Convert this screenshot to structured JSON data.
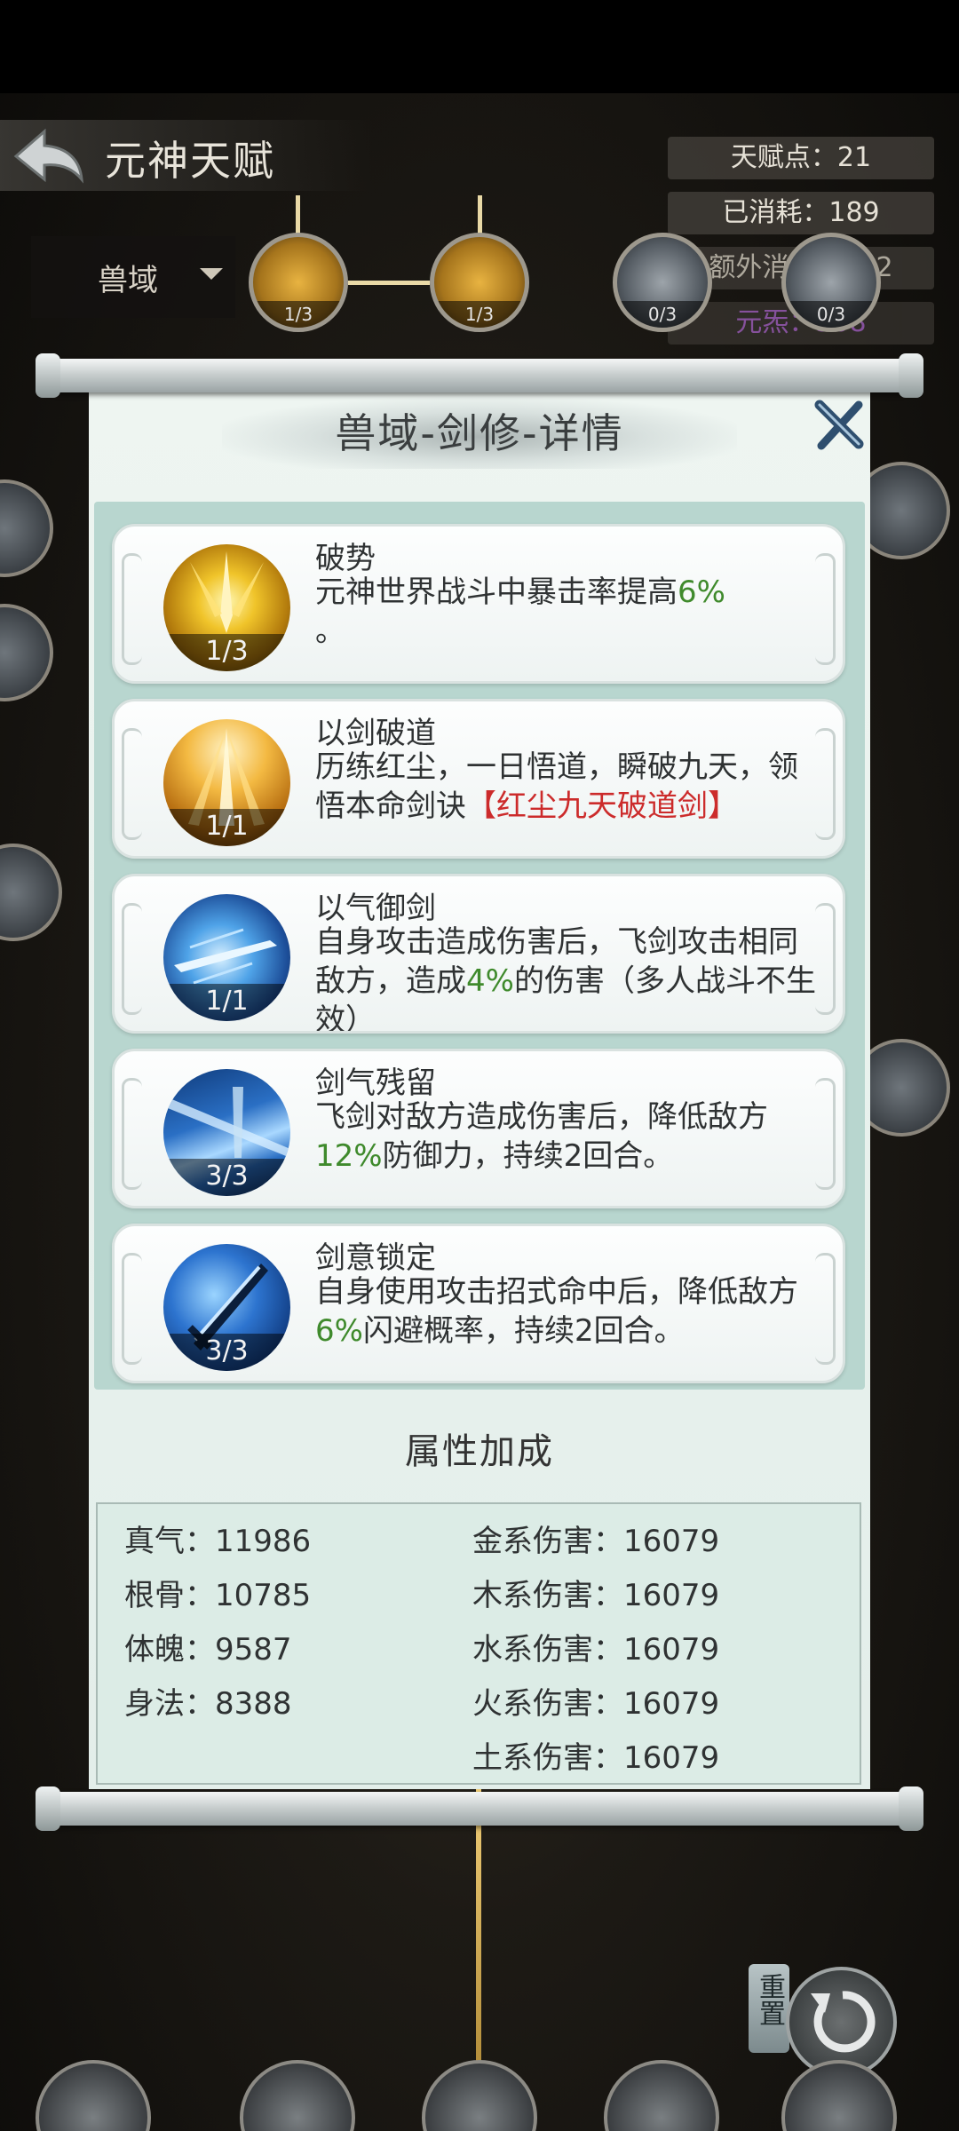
{
  "header": {
    "title": "元神天赋"
  },
  "stats": {
    "talent_points": "天赋点：21",
    "consumed": "已消耗：189",
    "extra_consumed": "额外消耗：162",
    "element": "元炁：308"
  },
  "region_selector": {
    "value": "兽域"
  },
  "tree_nodes": {
    "node1_level": "1/3",
    "node2_level": "1/3",
    "node3_level": "0/3",
    "node4_level": "0/3"
  },
  "dialog": {
    "title": "兽域-剑修-详情",
    "skills": [
      {
        "name": "破势",
        "level": "1/3",
        "desc_pre": "元神世界战斗中暴击率提高",
        "desc_value": "6%",
        "desc_post": "。"
      },
      {
        "name": "以剑破道",
        "level": "1/1",
        "desc_pre": "历练红尘，一日悟道，瞬破九天，领悟本命剑诀",
        "desc_value": "【红尘九天破道剑】",
        "desc_post": ""
      },
      {
        "name": "以气御剑",
        "level": "1/1",
        "desc_pre": "自身攻击造成伤害后，飞剑攻击相同敌方，造成",
        "desc_value": "4%",
        "desc_post": "的伤害（多人战斗不生效）"
      },
      {
        "name": "剑气残留",
        "level": "3/3",
        "desc_pre": "飞剑对敌方造成伤害后，降低敌方",
        "desc_value": "12%",
        "desc_post": "防御力，持续2回合。"
      },
      {
        "name": "剑意锁定",
        "level": "3/3",
        "desc_pre": "自身使用攻击招式命中后，降低敌方",
        "desc_value": "6%",
        "desc_post": "闪避概率，持续2回合。"
      }
    ],
    "attributes_title": "属性加成",
    "attributes_left": [
      "真气：11986",
      "根骨：10785",
      "体魄：9587",
      "身法：8388"
    ],
    "attributes_right": [
      "金系伤害：16079",
      "木系伤害：16079",
      "水系伤害：16079",
      "火系伤害：16079",
      "土系伤害：16079"
    ]
  },
  "footer": {
    "reset_label": "重置"
  },
  "colors": {
    "highlight_green": "#3f8a2c",
    "highlight_red": "#cc2b2b",
    "scroll_paper": "#e6f0ec"
  }
}
